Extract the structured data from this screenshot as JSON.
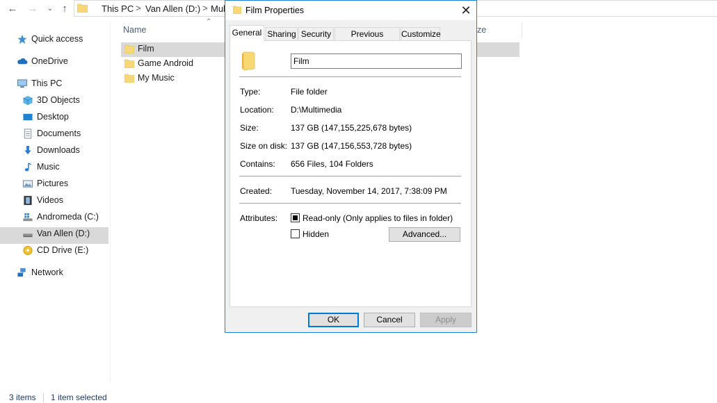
{
  "explorer": {
    "breadcrumb": [
      "This PC",
      "Van Allen (D:)",
      "Mul"
    ],
    "breadcrumb_sep": ">",
    "columns": {
      "name": "Name",
      "size": "ze"
    },
    "files": [
      {
        "name": "Film",
        "selected": true
      },
      {
        "name": "Game Android",
        "selected": false
      },
      {
        "name": "My Music",
        "selected": false
      }
    ],
    "nav": [
      {
        "label": "Quick access",
        "icon": "star-icon"
      },
      {
        "label": "OneDrive",
        "icon": "cloud-icon"
      },
      {
        "label": "This PC",
        "icon": "computer-icon"
      },
      {
        "label": "3D Objects",
        "icon": "cube-icon"
      },
      {
        "label": "Desktop",
        "icon": "desktop-icon"
      },
      {
        "label": "Documents",
        "icon": "document-icon"
      },
      {
        "label": "Downloads",
        "icon": "download-icon"
      },
      {
        "label": "Music",
        "icon": "music-icon"
      },
      {
        "label": "Pictures",
        "icon": "pictures-icon"
      },
      {
        "label": "Videos",
        "icon": "video-icon"
      },
      {
        "label": "Andromeda (C:)",
        "icon": "windows-drive-icon"
      },
      {
        "label": "Van Allen (D:)",
        "icon": "drive-icon"
      },
      {
        "label": "CD Drive (E:)",
        "icon": "cd-drive-icon"
      },
      {
        "label": "Network",
        "icon": "network-icon"
      }
    ],
    "status": {
      "items": "3 items",
      "selection": "1 item selected"
    }
  },
  "dialog": {
    "title": "Film Properties",
    "tabs": [
      "General",
      "Sharing",
      "Security",
      "Previous Versions",
      "Customize"
    ],
    "active_tab": "General",
    "name_value": "Film",
    "properties": [
      {
        "label": "Type:",
        "value": "File folder"
      },
      {
        "label": "Location:",
        "value": "D:\\Multimedia"
      },
      {
        "label": "Size:",
        "value": "137 GB (147,155,225,678 bytes)"
      },
      {
        "label": "Size on disk:",
        "value": "137 GB (147,156,553,728 bytes)"
      },
      {
        "label": "Contains:",
        "value": "656 Files, 104 Folders"
      }
    ],
    "created": {
      "label": "Created:",
      "value": "Tuesday, November 14, 2017, 7:38:09 PM"
    },
    "attributes": {
      "label": "Attributes:",
      "readonly": {
        "label": "Read-only (Only applies to files in folder)",
        "state": "indeterminate"
      },
      "hidden": {
        "label": "Hidden",
        "state": "unchecked"
      },
      "advanced": "Advanced..."
    },
    "buttons": {
      "ok": "OK",
      "cancel": "Cancel",
      "apply": "Apply"
    }
  },
  "colors": {
    "accent": "#0078d7",
    "folder": "#f8d775",
    "selection": "#d9d9d9",
    "status_text": "#1e3b63"
  }
}
